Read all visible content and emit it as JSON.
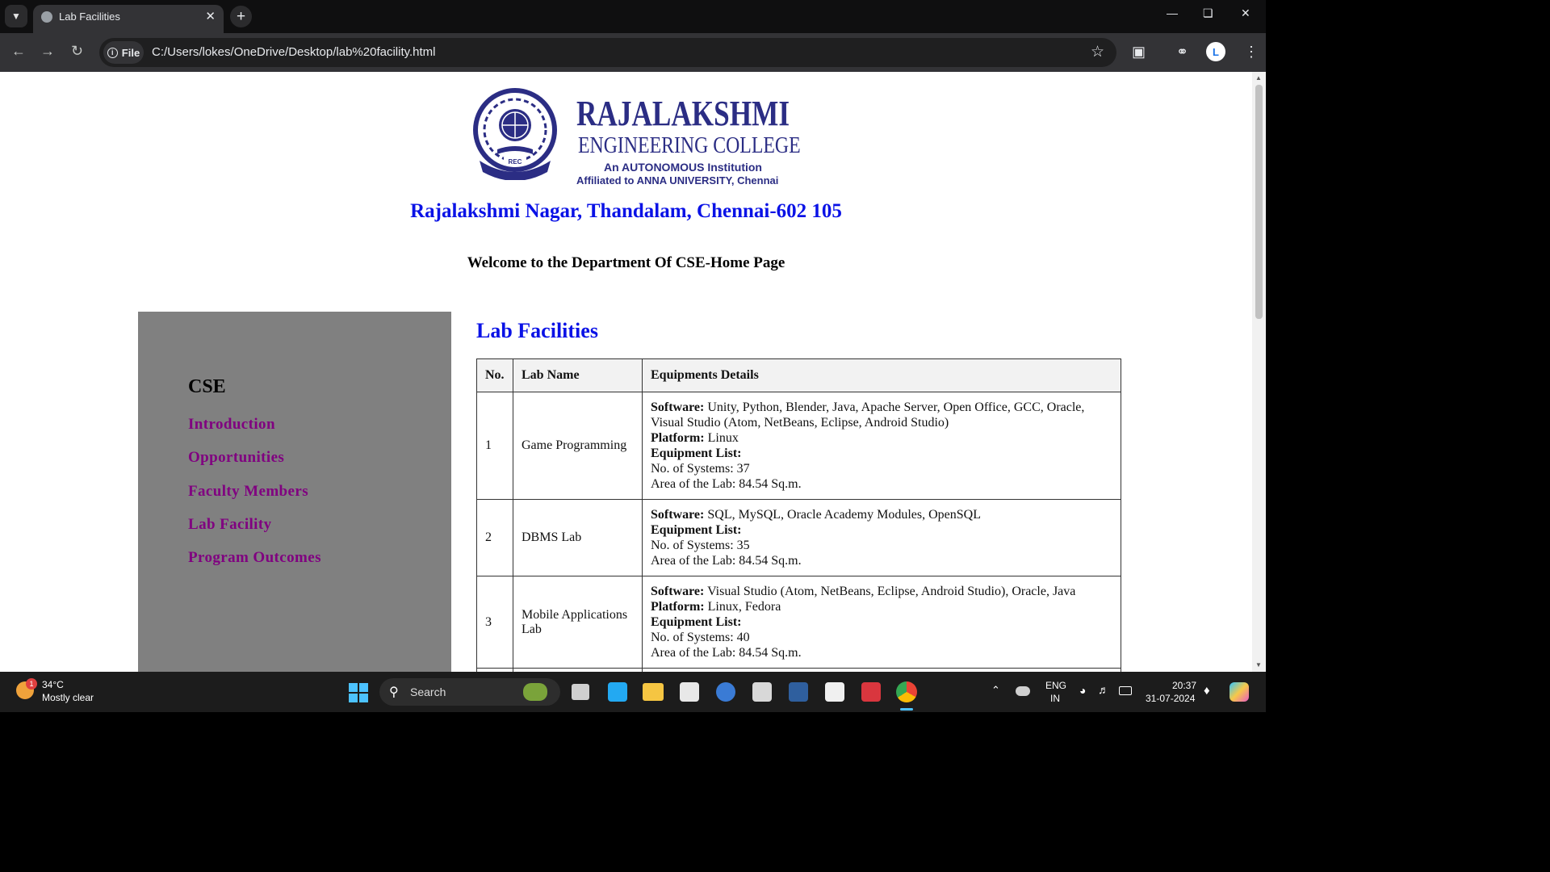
{
  "browser": {
    "tab_title": "Lab Facilities",
    "url_chip": "File",
    "url": "C:/Users/lokes/OneDrive/Desktop/lab%20facility.html",
    "profile_initial": "L"
  },
  "header": {
    "logo_name": "RAJALAKSHMI",
    "logo_sub": "ENGINEERING COLLEGE",
    "logo_line3": "An AUTONOMOUS Institution",
    "logo_line4": "Affiliated to ANNA UNIVERSITY, Chennai",
    "address": "Rajalakshmi Nagar, Thandalam, Chennai-602 105",
    "welcome": "Welcome to the Department Of CSE-Home Page"
  },
  "sidebar": {
    "heading": "CSE",
    "links": [
      "Introduction",
      "Opportunities",
      "Faculty Members",
      "Lab Facility",
      "Program Outcomes"
    ]
  },
  "main": {
    "title": "Lab Facilities",
    "headers": [
      "No.",
      "Lab Name",
      "Equipments Details"
    ],
    "rows": [
      {
        "no": "1",
        "name": "Game Programming",
        "software_label": "Software:",
        "software": "Unity, Python, Blender, Java, Apache Server, Open Office, GCC, Oracle, Visual Studio (Atom, NetBeans, Eclipse, Android Studio)",
        "platform_label": "Platform:",
        "platform": "Linux",
        "equipment_label": "Equipment List:",
        "systems": "No. of Systems: 37",
        "area": "Area of the Lab: 84.54 Sq.m."
      },
      {
        "no": "2",
        "name": "DBMS Lab",
        "software_label": "Software:",
        "software": "SQL, MySQL, Oracle Academy Modules, OpenSQL",
        "equipment_label": "Equipment List:",
        "systems": "No. of Systems: 35",
        "area": "Area of the Lab: 84.54 Sq.m."
      },
      {
        "no": "3",
        "name": "Mobile Applications Lab",
        "software_label": "Software:",
        "software": "Visual Studio (Atom, NetBeans, Eclipse, Android Studio), Oracle, Java",
        "platform_label": "Platform:",
        "platform": "Linux, Fedora",
        "equipment_label": "Equipment List:",
        "systems": "No. of Systems: 40",
        "area": "Area of the Lab: 84.54 Sq.m."
      }
    ]
  },
  "taskbar": {
    "weather_temp": "34°C",
    "weather_desc": "Mostly clear",
    "weather_badge": "1",
    "search_label": "Search",
    "lang_line1": "ENG",
    "lang_line2": "IN",
    "time": "20:37",
    "date": "31-07-2024"
  }
}
